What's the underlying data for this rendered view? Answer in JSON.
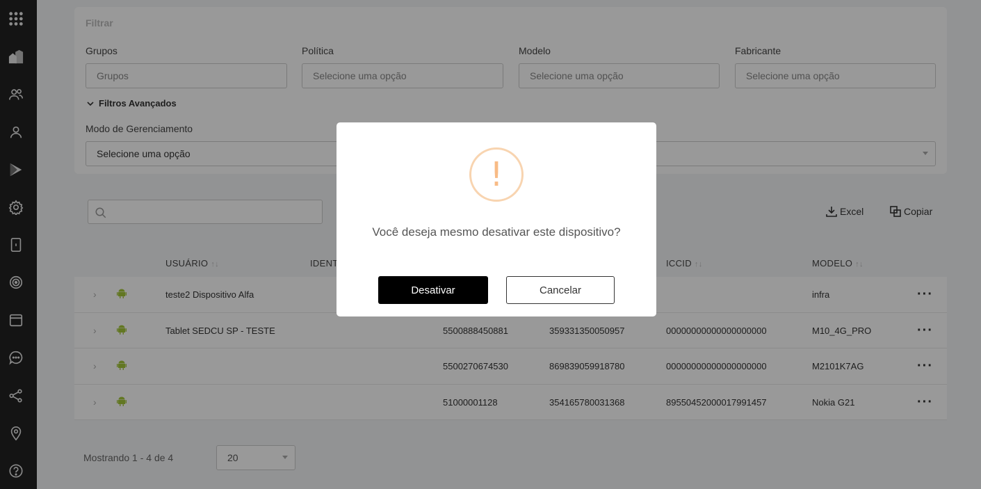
{
  "sidebar": {
    "icons": [
      "apps-grid-icon",
      "buildings-icon",
      "users-icon",
      "user-icon",
      "play-store-icon",
      "settings-icon",
      "device-icon",
      "target-icon",
      "calendar-icon",
      "chat-icon",
      "share-icon",
      "location-icon",
      "help-icon"
    ]
  },
  "filter": {
    "title": "Filtrar",
    "fields": [
      {
        "label": "Grupos",
        "placeholder": "Grupos"
      },
      {
        "label": "Política",
        "placeholder": "Selecione uma opção"
      },
      {
        "label": "Modelo",
        "placeholder": "Selecione uma opção"
      },
      {
        "label": "Fabricante",
        "placeholder": "Selecione uma opção"
      }
    ],
    "advanced_label": "Filtros Avançados",
    "mode_label": "Modo de Gerenciamento",
    "mode_value": "Selecione uma opção"
  },
  "toolbar": {
    "excel_label": "Excel",
    "copy_label": "Copiar"
  },
  "table": {
    "headers": {
      "usuario": "USUÁRIO",
      "ident": "IDENT",
      "iccid": "ICCID",
      "modelo": "MODELO"
    },
    "rows": [
      {
        "user": "teste2 Dispositivo Alfa",
        "col3": "",
        "col4": "",
        "iccid": "",
        "model": "infra"
      },
      {
        "user": "Tablet SEDCU SP - TESTE",
        "col3": "5500888450881",
        "col4": "359331350050957",
        "iccid": "00000000000000000000",
        "model": "M10_4G_PRO"
      },
      {
        "user": "",
        "col3": "5500270674530",
        "col4": "869839059918780",
        "iccid": "00000000000000000000",
        "model": "M2101K7AG"
      },
      {
        "user": "",
        "col3": "51000001128",
        "col4": "354165780031368",
        "iccid": "89550452000017991457",
        "model": "Nokia G21"
      }
    ]
  },
  "pager": {
    "text": "Mostrando 1 - 4 de 4",
    "page_size": "20"
  },
  "modal": {
    "icon": "!",
    "message": "Você deseja mesmo desativar este dispositivo?",
    "confirm_label": "Desativar",
    "cancel_label": "Cancelar"
  }
}
